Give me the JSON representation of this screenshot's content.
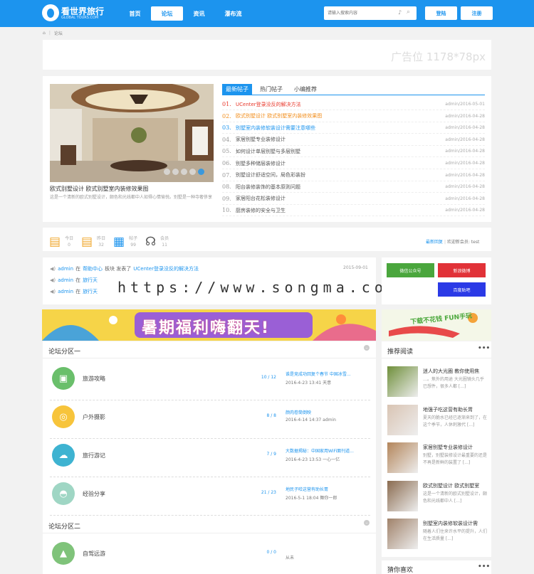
{
  "header": {
    "logo_text": "看世界旅行",
    "logo_sub": "GLOBAL TOURS.COM",
    "nav": [
      "首页",
      "论坛",
      "资讯",
      "瀑布流"
    ],
    "search_placeholder": "请输入搜索内容",
    "login": "登陆",
    "register": "注册"
  },
  "breadcrumb": {
    "current": "论坛"
  },
  "ad": {
    "text": "广告位 1178*78px"
  },
  "slider": {
    "title": "欧式别墅设计 欧式别墅室内装修效果图",
    "desc": "这是一个清新的欧式别墅设计，颇色和光线都中人如得心情愉悦。别墅是一种寺奢侈享"
  },
  "news": {
    "tabs": [
      "最新帖子",
      "热门帖子",
      "小编推荐"
    ],
    "items": [
      {
        "n": "01.",
        "title": "UCenter登录没反的解决方法",
        "meta": "admin/2016-05-01",
        "color": "#e8382b"
      },
      {
        "n": "02.",
        "title": "欧式别墅设计 欧式别墅室内装修效果图",
        "meta": "admin/2016-04-28",
        "color": "#f28e1c"
      },
      {
        "n": "03.",
        "title": "别墅室内装修软装设计需要注意哪些",
        "meta": "admin/2016-04-28",
        "color": "#1c94ee"
      },
      {
        "n": "04.",
        "title": "家居别墅专业装修设计",
        "meta": "admin/2016-04-28",
        "color": ""
      },
      {
        "n": "05.",
        "title": "如何设计单层别墅与多层别墅",
        "meta": "admin/2016-04-28",
        "color": ""
      },
      {
        "n": "06.",
        "title": "别墅多种储层装修设计",
        "meta": "admin/2016-04-28",
        "color": ""
      },
      {
        "n": "07.",
        "title": "别墅设计舒适空间，局色彩装扮",
        "meta": "admin/2016-04-28",
        "color": ""
      },
      {
        "n": "08.",
        "title": "阳台装修装饰的基本原则问题",
        "meta": "admin/2016-04-28",
        "color": ""
      },
      {
        "n": "09.",
        "title": "家居阳台花松装修设计",
        "meta": "admin/2016-04-28",
        "color": ""
      },
      {
        "n": "10.",
        "title": "厨房装修的安全与卫生",
        "meta": "admin/2016-04-28",
        "color": ""
      }
    ]
  },
  "stats": [
    {
      "label": "今日",
      "value": "0",
      "icon": "calendar-today-icon",
      "glyph": "▤",
      "color": "#f0a830"
    },
    {
      "label": "昨日",
      "value": "32",
      "icon": "calendar-yesterday-icon",
      "glyph": "▤",
      "color": "#f0a830"
    },
    {
      "label": "帖子",
      "value": "99",
      "icon": "post-icon",
      "glyph": "▦",
      "color": "#1c94ee"
    },
    {
      "label": "会员",
      "value": "11",
      "icon": "member-icon",
      "glyph": "☊",
      "color": "#555"
    }
  ],
  "stats_right": {
    "latest": "最新回复",
    "welcome": "欢迎新会员: test"
  },
  "feed": [
    {
      "user": "admin",
      "in": "在",
      "forum": "帮助中心",
      "action": "板块 发表了",
      "topic": "UCenter登录没反的解决方法",
      "date": "2015-09-01"
    },
    {
      "user": "admin",
      "in": "在",
      "forum": "旅行天",
      "action": "",
      "topic": "",
      "date": ""
    },
    {
      "user": "admin",
      "in": "在",
      "forum": "旅行天",
      "action": "",
      "topic": "",
      "date": ""
    }
  ],
  "watermark": "https://www.songma.com",
  "social": [
    {
      "label": "微信公众号",
      "color": "#4aa63d"
    },
    {
      "label": "新浪微博",
      "color": "#e13238"
    },
    {
      "label": "百度贴吧",
      "color": "#2b3ae6"
    }
  ],
  "banner": {
    "text": "暑期福利嗨翻天!",
    "side": "下载不花钱 FUN手玩"
  },
  "sections": [
    {
      "title": "论坛分区一",
      "forums": [
        {
          "name": "旅游攻略",
          "count": "10 / 12",
          "last": "谁是竞成功回复个春节 中国冰雪...",
          "meta": "2016-4-23 13:41 天意",
          "color": "#6abf6b",
          "icon": "tv-icon",
          "glyph": "▣"
        },
        {
          "name": "户外摄影",
          "count": "8 / 8",
          "last": "颜肉卷筒倒映",
          "meta": "2016-4-14 14:37 admin",
          "color": "#f7c43b",
          "icon": "camera-icon",
          "glyph": "◎"
        },
        {
          "name": "旅行游记",
          "count": "7 / 9",
          "last": "大数据揭秘：中国家用WiFi面刊道...",
          "meta": "2016-4-23 13:53 一心一亿",
          "color": "#3eb3d1",
          "icon": "cloud-icon",
          "glyph": "☁"
        },
        {
          "name": "经验分享",
          "count": "21 / 23",
          "last": "地民子哈这营有助长胃",
          "meta": "2016-5-1 18:04 舞你一郎",
          "color": "#9fd6c4",
          "icon": "balloon-icon",
          "glyph": "◓"
        }
      ]
    },
    {
      "title": "论坛分区二",
      "forums": [
        {
          "name": "自驾远游",
          "count": "0 / 0",
          "last": "",
          "meta": "从未",
          "color": "#7fc37a",
          "icon": "landscape-icon",
          "glyph": "▲"
        }
      ]
    }
  ],
  "recommend": {
    "title": "推荐阅读",
    "items": [
      {
        "title": "迷人的大光圈 教你使用焦",
        "desc": "…。焦外的用途 大光圈镜头几乎已想件，很多人都 [...]"
      },
      {
        "title": "地强子吃这营有助长胃",
        "desc": "夏天的脆水已经已逐渐来到了，在这个季节，人休刺激代 [...]"
      },
      {
        "title": "家居别墅专业装修设计",
        "desc": "别墅，别墅装修设计最重要的还是不再是新鲜的装置了 [...]"
      },
      {
        "title": "欧式别墅设计 欧式别墅室",
        "desc": "这是一个清新的欧式别墅设计，颇色和光线都中人 [...]"
      },
      {
        "title": "别墅室内装修软装设计需",
        "desc": "随着人们住来许水平的提升，人们在生活质量 [...]"
      }
    ]
  },
  "guess": {
    "title": "猜你喜欢"
  },
  "more": "•••",
  "colors": {
    "brand": "#1c94ee"
  }
}
